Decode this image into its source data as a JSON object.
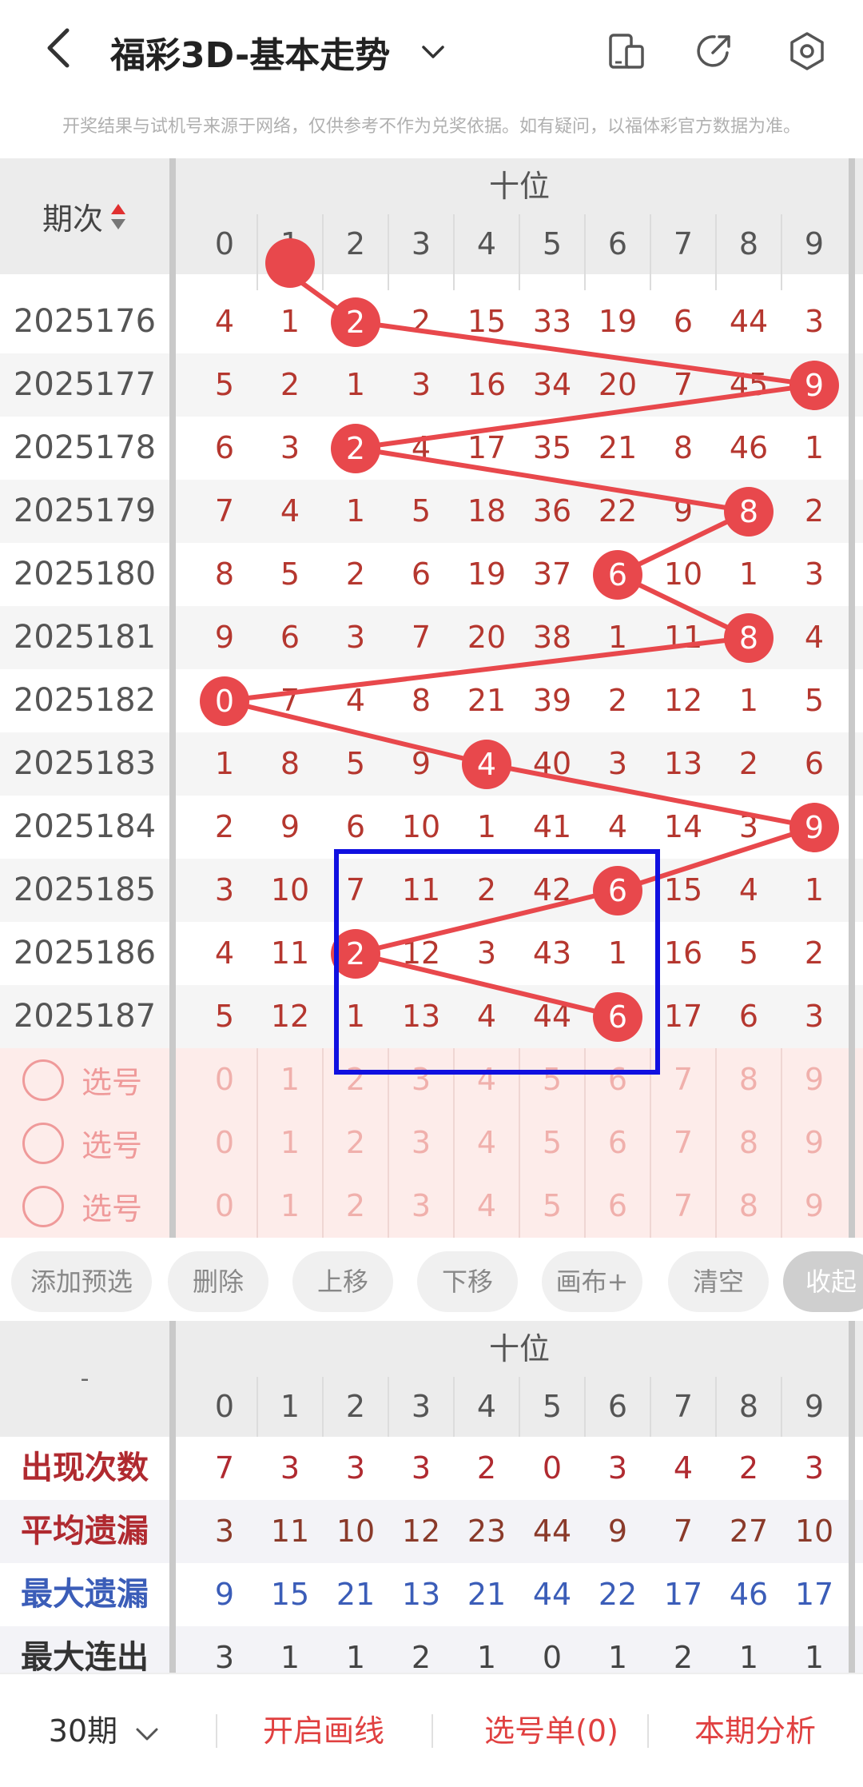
{
  "header": {
    "title": "福彩3D-基本走势",
    "icons": [
      "back-arrow-icon",
      "chevron-down-icon",
      "device-icon",
      "share-icon",
      "settings-icon"
    ]
  },
  "notice": "开奖结果与试机号来源于网络，仅供参考不作为兑奖依据。如有疑问，以福体彩官方数据为准。",
  "trend": {
    "period_label": "期次",
    "section_label": "十位",
    "digits": [
      "0",
      "1",
      "2",
      "3",
      "4",
      "5",
      "6",
      "7",
      "8",
      "9"
    ],
    "rows": [
      {
        "period": "2025176",
        "cells": [
          "4",
          "1",
          "2",
          "2",
          "15",
          "33",
          "19",
          "6",
          "44",
          "3"
        ],
        "hit": 2
      },
      {
        "period": "2025177",
        "cells": [
          "5",
          "2",
          "1",
          "3",
          "16",
          "34",
          "20",
          "7",
          "45",
          "9"
        ],
        "hit": 9
      },
      {
        "period": "2025178",
        "cells": [
          "6",
          "3",
          "2",
          "4",
          "17",
          "35",
          "21",
          "8",
          "46",
          "1"
        ],
        "hit": 2
      },
      {
        "period": "2025179",
        "cells": [
          "7",
          "4",
          "1",
          "5",
          "18",
          "36",
          "22",
          "9",
          "8",
          "2"
        ],
        "hit": 8
      },
      {
        "period": "2025180",
        "cells": [
          "8",
          "5",
          "2",
          "6",
          "19",
          "37",
          "6",
          "10",
          "1",
          "3"
        ],
        "hit": 6
      },
      {
        "period": "2025181",
        "cells": [
          "9",
          "6",
          "3",
          "7",
          "20",
          "38",
          "1",
          "11",
          "8",
          "4"
        ],
        "hit": 8
      },
      {
        "period": "2025182",
        "cells": [
          "0",
          "7",
          "4",
          "8",
          "21",
          "39",
          "2",
          "12",
          "1",
          "5"
        ],
        "hit": 0
      },
      {
        "period": "2025183",
        "cells": [
          "1",
          "8",
          "5",
          "9",
          "4",
          "40",
          "3",
          "13",
          "2",
          "6"
        ],
        "hit": 4
      },
      {
        "period": "2025184",
        "cells": [
          "2",
          "9",
          "6",
          "10",
          "1",
          "41",
          "4",
          "14",
          "3",
          "9"
        ],
        "hit": 9
      },
      {
        "period": "2025185",
        "cells": [
          "3",
          "10",
          "7",
          "11",
          "2",
          "42",
          "6",
          "15",
          "4",
          "1"
        ],
        "hit": 6
      },
      {
        "period": "2025186",
        "cells": [
          "4",
          "11",
          "2",
          "12",
          "3",
          "43",
          "1",
          "16",
          "5",
          "2"
        ],
        "hit": 2
      },
      {
        "period": "2025187",
        "cells": [
          "5",
          "12",
          "1",
          "13",
          "4",
          "44",
          "6",
          "17",
          "6",
          "3"
        ],
        "hit": 6
      }
    ],
    "pick_rows": [
      {
        "label": "选号",
        "digits": [
          "0",
          "1",
          "2",
          "3",
          "4",
          "5",
          "6",
          "7",
          "8",
          "9"
        ]
      },
      {
        "label": "选号",
        "digits": [
          "0",
          "1",
          "2",
          "3",
          "4",
          "5",
          "6",
          "7",
          "8",
          "9"
        ]
      },
      {
        "label": "选号",
        "digits": [
          "0",
          "1",
          "2",
          "3",
          "4",
          "5",
          "6",
          "7",
          "8",
          "9"
        ]
      }
    ]
  },
  "toolbar": [
    "添加预选",
    "删除",
    "上移",
    "下移",
    "画布+",
    "清空",
    "收起"
  ],
  "stats": {
    "corner_label": "-",
    "section_label": "十位",
    "digits": [
      "0",
      "1",
      "2",
      "3",
      "4",
      "5",
      "6",
      "7",
      "8",
      "9"
    ],
    "rows": [
      {
        "label": "出现次数",
        "values": [
          "7",
          "3",
          "3",
          "3",
          "2",
          "0",
          "3",
          "4",
          "2",
          "3"
        ],
        "label_color": "#b02a30",
        "value_color": "#b02a30"
      },
      {
        "label": "平均遗漏",
        "values": [
          "3",
          "11",
          "10",
          "12",
          "23",
          "44",
          "9",
          "7",
          "27",
          "10"
        ],
        "label_color": "#b02a30",
        "value_color": "#8a3a2a"
      },
      {
        "label": "最大遗漏",
        "values": [
          "9",
          "15",
          "21",
          "13",
          "21",
          "44",
          "22",
          "17",
          "46",
          "17"
        ],
        "label_color": "#3b5db8",
        "value_color": "#3b5db8"
      },
      {
        "label": "最大连出",
        "values": [
          "3",
          "1",
          "1",
          "2",
          "1",
          "0",
          "1",
          "2",
          "1",
          "1"
        ],
        "label_color": "#333333",
        "value_color": "#444444"
      }
    ]
  },
  "bottom": {
    "period_select": "30期",
    "draw_line": "开启画线",
    "pick_list": "选号单(0)",
    "analysis": "本期分析"
  }
}
